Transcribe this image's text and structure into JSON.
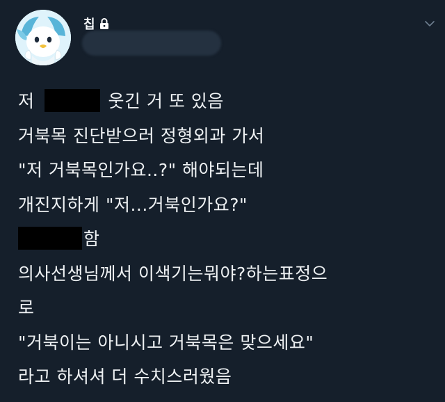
{
  "tweet": {
    "display_name": "칩",
    "lines": {
      "l1_before": "저",
      "l1_after": "웃긴 거 또 있음",
      "l2": "거북목 진단받으러 정형외과 가서",
      "l3": "\"저 거북목인가요..?\" 해야되는데",
      "l4": "개진지하게 \"저...거북인가요?\"",
      "l5_after": "함",
      "l6": "의사선생님께서 이색기는뭐야?하는표정으",
      "l7": "로",
      "l8": "\"거북이는 아니시고 거북목은 맞으세요\"",
      "l9": "라고 하셔셔 더 수치스러웠음"
    }
  },
  "icons": {
    "lock": "lock-icon",
    "menu": "chevron-down-icon"
  },
  "colors": {
    "background": "#151f2b",
    "text": "#eef1f3",
    "redaction": "#000000"
  }
}
